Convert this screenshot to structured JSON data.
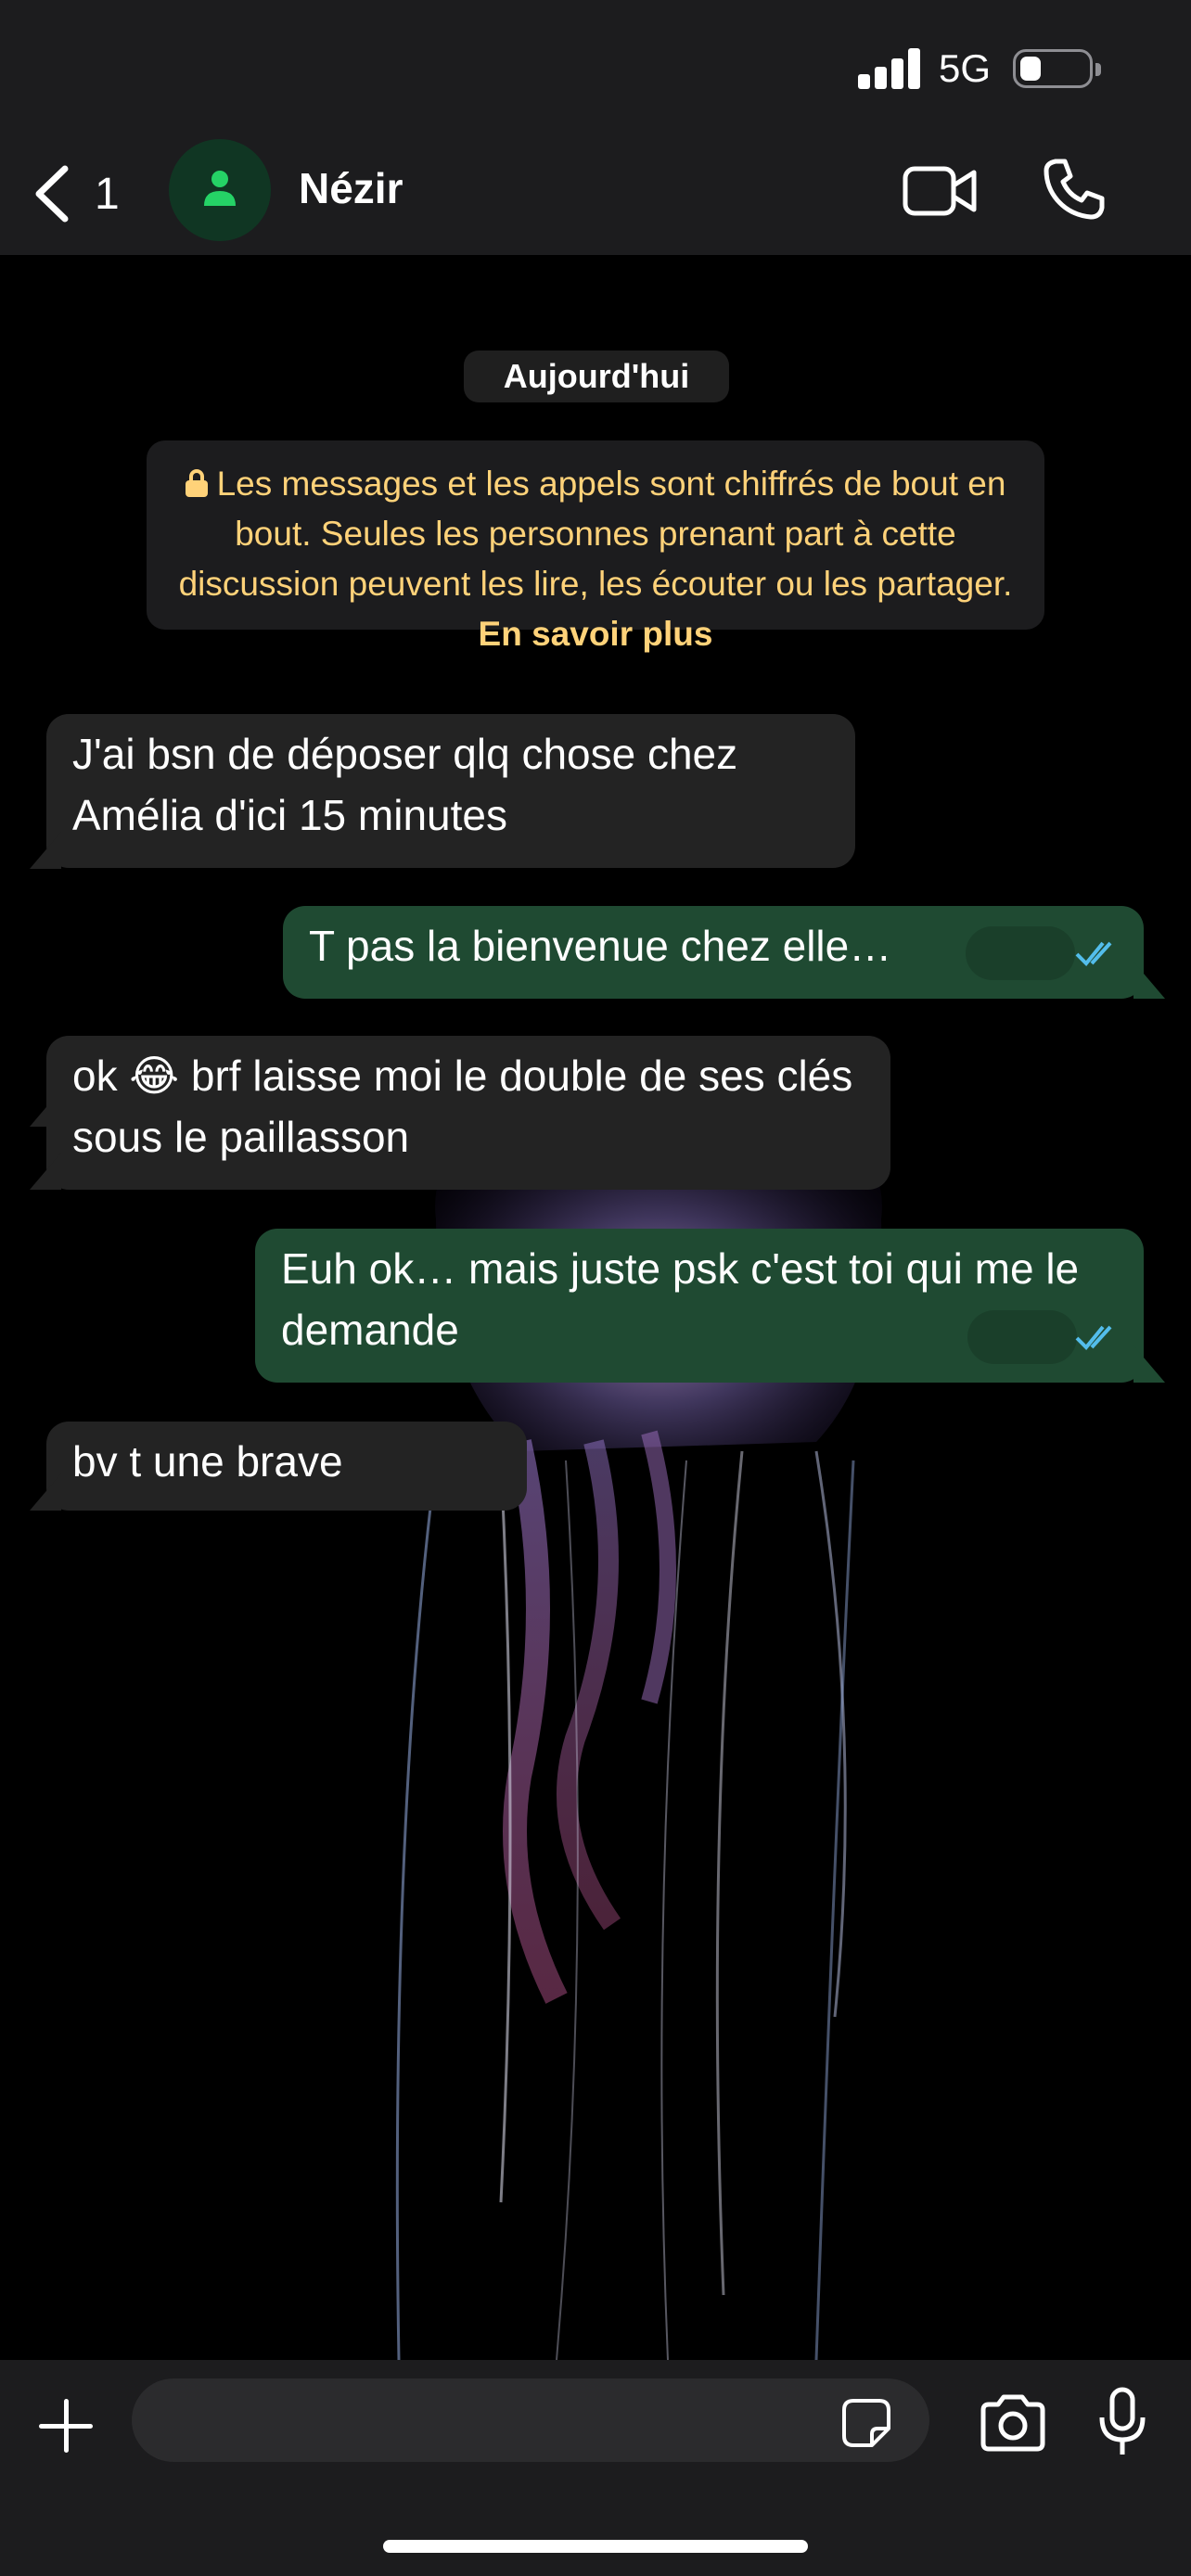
{
  "status_bar": {
    "network": "5G",
    "icons": [
      "signal-icon",
      "battery-icon"
    ]
  },
  "header": {
    "back_count": "1",
    "contact_name": "Nézir",
    "icons": [
      "chevron-left-icon",
      "person-icon",
      "video-camera-icon",
      "phone-icon"
    ]
  },
  "chat": {
    "date_label": "Aujourd'hui",
    "encryption_notice": {
      "text": "Les messages et les appels sont chiffrés de bout en bout. Seules les personnes prenant part à cette discussion peuvent les lire, les écouter ou les partager.",
      "link": "En savoir plus"
    },
    "messages": [
      {
        "direction": "incoming",
        "text": "J'ai bsn de déposer qlq chose chez Amélia d'ici 15 minutes"
      },
      {
        "direction": "outgoing",
        "text": "T pas la bienvenue chez elle…",
        "status": "read"
      },
      {
        "direction": "incoming",
        "text": "ok 😂 brf laisse moi le double de ses clés sous le paillasson"
      },
      {
        "direction": "outgoing",
        "text": "Euh ok… mais juste psk c'est toi qui me le demande",
        "status": "read"
      },
      {
        "direction": "incoming",
        "text": "bv t une brave"
      }
    ]
  },
  "input_bar": {
    "placeholder": "",
    "icons": [
      "plus-icon",
      "sticker-icon",
      "camera-icon",
      "microphone-icon"
    ]
  },
  "colors": {
    "header_bg": "#1c1c1e",
    "incoming_bubble": "#232323",
    "outgoing_bubble": "#1f4a32",
    "notice_text": "#ffd279",
    "read_ticks": "#53bdeb"
  }
}
